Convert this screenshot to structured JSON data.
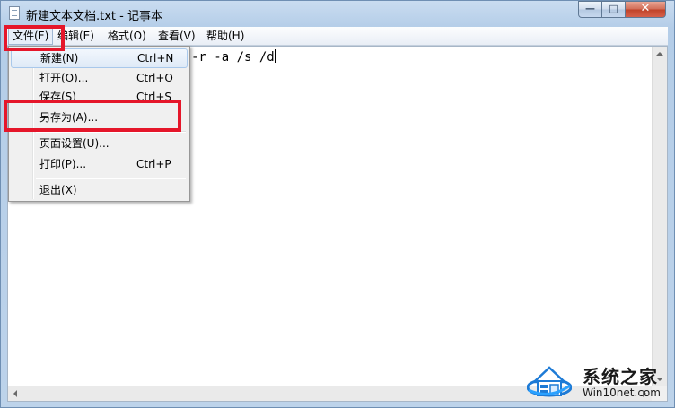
{
  "window": {
    "title": "新建文本文档.txt - 记事本",
    "buttons": {
      "minimize": "—",
      "maximize": "□",
      "close": "✕"
    }
  },
  "menubar": {
    "items": [
      "文件(F)",
      "编辑(E)",
      "格式(O)",
      "查看(V)",
      "帮助(H)"
    ],
    "active": "文件(F)"
  },
  "file_menu": {
    "items": [
      {
        "label": "新建(N)",
        "shortcut": "Ctrl+N"
      },
      {
        "label": "打开(O)...",
        "shortcut": "Ctrl+O"
      },
      {
        "label": "保存(S)",
        "shortcut": "Ctrl+S"
      },
      {
        "label": "另存为(A)...",
        "shortcut": ""
      },
      {
        "label": "页面设置(U)...",
        "shortcut": ""
      },
      {
        "label": "打印(P)...",
        "shortcut": "Ctrl+P"
      },
      {
        "label": "退出(X)",
        "shortcut": ""
      }
    ],
    "highlighted": "新建(N)"
  },
  "editor": {
    "visible_text": "-r -a /s /d"
  },
  "annotations": {
    "highlight_color": "#e5162a"
  },
  "watermark": {
    "title": "系统之家",
    "subtitle": "Win10net.com"
  },
  "colors": {
    "close_button": "#c0432a",
    "menu_highlight_border": "#a8c8eb"
  }
}
